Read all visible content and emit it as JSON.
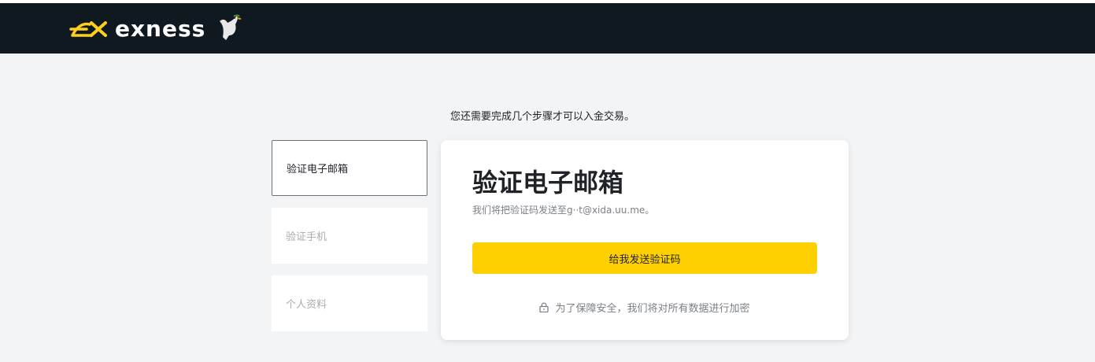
{
  "header": {
    "brand": "exness",
    "logo_icon": "exness-logo-mark",
    "decoration_icon": "dove-icon",
    "background": "#101820"
  },
  "intro_text": "您还需要完成几个步骤才可以入金交易。",
  "steps": [
    {
      "label": "验证电子邮箱",
      "active": true
    },
    {
      "label": "验证手机",
      "active": false
    },
    {
      "label": "个人资料",
      "active": false
    }
  ],
  "card": {
    "title": "验证电子邮箱",
    "subtitle": "我们将把验证码发送至g··t@xida.uu.me。",
    "button_label": "给我发送验证码",
    "button_color": "#ffd000",
    "security_note": "为了保障安全，我们将对所有数据进行加密",
    "security_icon": "lock-icon"
  }
}
